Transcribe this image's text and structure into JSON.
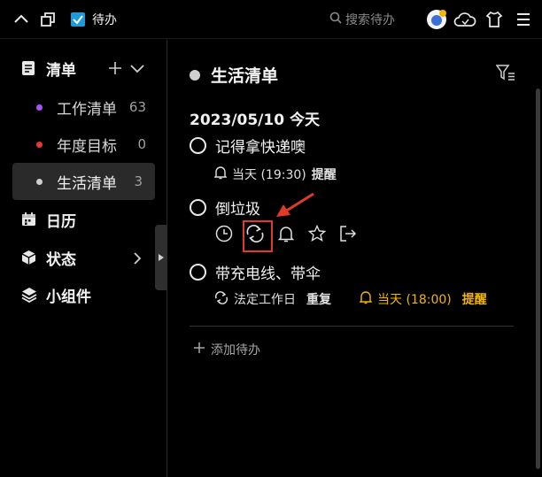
{
  "titlebar": {
    "app_title": "待办",
    "search_placeholder": "搜索待办"
  },
  "sidebar": {
    "list_header": "清单",
    "lists": [
      {
        "label": "工作清单",
        "count": "63",
        "color": "#a855f7"
      },
      {
        "label": "年度目标",
        "count": "0",
        "color": "#e53935"
      },
      {
        "label": "生活清单",
        "count": "3",
        "color": "#d0d0d0"
      }
    ],
    "calendar_label": "日历",
    "status_label": "状态",
    "widget_label": "小组件"
  },
  "main": {
    "list_title": "生活清单",
    "date_heading": "2023/05/10  今天",
    "tasks": [
      {
        "title": "记得拿快递噢",
        "remind_day": "当天 (19:30)",
        "remind_label": "提醒"
      },
      {
        "title": "倒垃圾"
      },
      {
        "title": "带充电线、带伞",
        "repeat_rule": "法定工作日",
        "repeat_label": "重复",
        "remind_day": "当天 (18:00)",
        "remind_label": "提醒"
      }
    ],
    "add_todo": "添加待办"
  },
  "colors": {
    "accent_yellow": "#f2b600",
    "highlight_red": "#e23a2a",
    "checkbox_blue": "#1e9bd7"
  }
}
